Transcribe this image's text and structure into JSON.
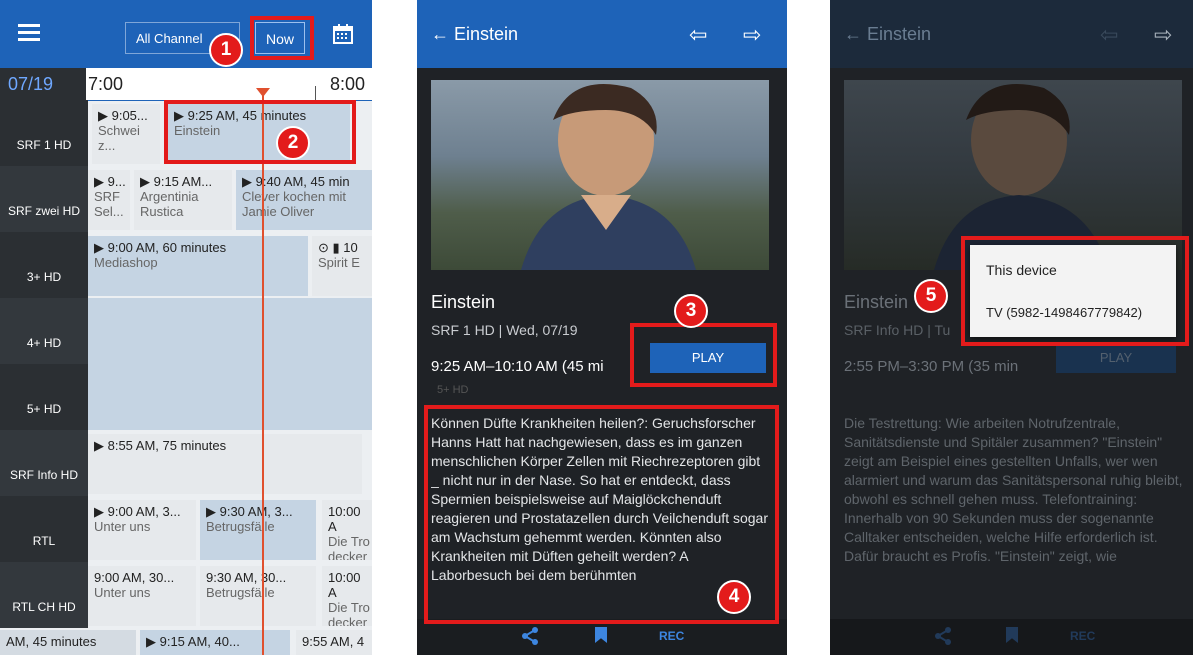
{
  "screen1": {
    "channels_filter": "All Channel",
    "now_label": "Now",
    "date": "07/19",
    "time_start": "7:00",
    "time_end": "8:00",
    "channels": [
      "SRF 1 HD",
      "SRF zwei HD",
      "3+ HD",
      "4+ HD",
      "5+ HD",
      "SRF Info HD",
      "RTL",
      "RTL CH HD"
    ],
    "programs": {
      "srf1_a_time": "▶ 9:05...",
      "srf1_a_title": "Schwei z...",
      "srf1_b_time": "▶ 9:25 AM, 45 minutes",
      "srf1_b_title": "Einstein",
      "srf2_a_time": "▶ 9...",
      "srf2_a_title": "SRF Sel...",
      "srf2_b_time": "▶ 9:15 AM...",
      "srf2_b_title": "Argentinia Rustica",
      "srf2_c_time": "▶ 9:40 AM, 45 min",
      "srf2_c_title": "Clever kochen mit Jamie Oliver",
      "p3_a_time": "▶ 9:00 AM, 60 minutes",
      "p3_a_title": "Mediashop",
      "p3_b_time": "⊙ ▮ 10",
      "p3_b_title": "Spirit E",
      "info_a_time": "▶ 8:55 AM, 75 minutes",
      "rtl_a_time": "▶ 9:00 AM, 3...",
      "rtl_a_title": "Unter uns",
      "rtl_b_time": "▶ 9:30 AM, 3...",
      "rtl_b_title": "Betrugsfälle",
      "rtl_c_time": "10:00 A",
      "rtl_c_title": "Die Tro decker",
      "rtlch_a_time": "9:00 AM, 30...",
      "rtlch_a_title": "Unter uns",
      "rtlch_b_time": "9:30 AM, 30...",
      "rtlch_b_title": "Betrugsfälle",
      "rtlch_c_time": "10:00 A",
      "rtlch_c_title": "Die Tro decker",
      "last_a": "AM, 45 minutes",
      "last_b": "▶ 9:15 AM, 40...",
      "last_c": "9:55 AM, 4"
    }
  },
  "screen2": {
    "back_title": "← Einstein",
    "title": "Einstein",
    "subtitle": "SRF 1 HD | Wed, 07/19",
    "time": "9:25 AM–10:10 AM (45 mi",
    "play": "PLAY",
    "ghost": "5+ HD",
    "description": "Können Düfte Krankheiten heilen?: Geruchsforscher Hanns Hatt hat nachgewiesen, dass es im ganzen menschlichen Körper Zellen mit Riechrezeptoren gibt _ nicht nur in der Nase. So hat er entdeckt, dass Spermien beispielsweise auf Maiglöckchenduft reagieren und Prostatazellen durch Veilchenduft sogar am Wachstum gehemmt werden. Könnten also Krankheiten mit Düften geheilt werden? A Laborbesuch bei dem berühmten",
    "rec": "REC"
  },
  "screen3": {
    "back_title": "← Einstein",
    "title": "Einstein",
    "subtitle": "SRF Info HD | Tu",
    "time": "2:55 PM–3:30 PM (35 min",
    "play": "PLAY",
    "option1": "This device",
    "option2": "TV (5982-1498467779842)",
    "description": "Die Testrettung: Wie arbeiten Notrufzentrale, Sanitätsdienste und Spitäler zusammen? \"Einstein\" zeigt am Beispiel eines gestellten Unfalls, wer wen alarmiert und warum das Sanitätspersonal ruhig bleibt, obwohl es schnell gehen muss. Telefontraining: Innerhalb von 90 Sekunden muss der sogenannte Calltaker entscheiden, welche Hilfe erforderlich ist. Dafür braucht es Profis. \"Einstein\" zeigt, wie",
    "rec": "REC"
  },
  "callouts": [
    "1",
    "2",
    "3",
    "4",
    "5"
  ],
  "colors": {
    "accent": "#1e63b8",
    "highlight": "#e31b1b",
    "dark_bg": "#1f2226"
  }
}
